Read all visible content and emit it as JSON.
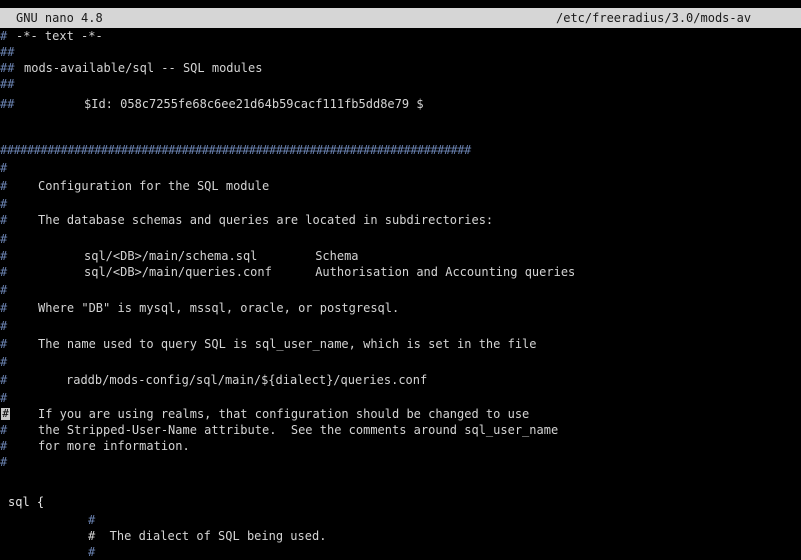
{
  "titlebar": {
    "app_name": "GNU nano 4.8",
    "file_path": "/etc/freeradius/3.0/mods-av"
  },
  "lines": [
    {
      "hash": "#",
      "text": "-*- text -*-"
    },
    {
      "hash": "##",
      "text": ""
    },
    {
      "hash": "##",
      "text": "mods-available/sql -- SQL modules"
    },
    {
      "hash": "##",
      "text": ""
    },
    {
      "hash": "##",
      "text": "$Id: 058c7255fe68c6ee21d64b59cacf111fb5dd8e79 $"
    },
    {
      "hash": "",
      "text": ""
    },
    {
      "hash": "",
      "text": "######################################################################"
    },
    {
      "hash": "#",
      "text": ""
    },
    {
      "hash": "#",
      "text": "Configuration for the SQL module"
    },
    {
      "hash": "#",
      "text": ""
    },
    {
      "hash": "#",
      "text": "The database schemas and queries are located in subdirectories:"
    },
    {
      "hash": "#",
      "text": ""
    },
    {
      "hash": "#",
      "text": "sql/<DB>/main/schema.sql        Schema"
    },
    {
      "hash": "#",
      "text": "sql/<DB>/main/queries.conf      Authorisation and Accounting queries"
    },
    {
      "hash": "#",
      "text": ""
    },
    {
      "hash": "#",
      "text": "Where \"DB\" is mysql, mssql, oracle, or postgresql."
    },
    {
      "hash": "#",
      "text": ""
    },
    {
      "hash": "#",
      "text": "The name used to query SQL is sql_user_name, which is set in the file"
    },
    {
      "hash": "#",
      "text": ""
    },
    {
      "hash": "#",
      "text": "raddb/mods-config/sql/main/${dialect}/queries.conf"
    },
    {
      "hash": "#",
      "text": ""
    },
    {
      "hash": "#",
      "text": "If you are using realms, that configuration should be changed to use"
    },
    {
      "hash": "#",
      "text": "the Stripped-User-Name attribute.  See the comments around sql_user_name"
    },
    {
      "hash": "#",
      "text": "for more information."
    },
    {
      "hash": "#",
      "text": ""
    },
    {
      "hash": "",
      "text": ""
    },
    {
      "hash": "",
      "text": "sql {"
    },
    {
      "hash": "",
      "text": "#"
    },
    {
      "hash": "",
      "text": "#  The dialect of SQL being used."
    },
    {
      "hash": "",
      "text": "#"
    }
  ],
  "colors": {
    "background": "#000000",
    "titlebar": "#d6d6d6",
    "comment_hash": "#6a82b0",
    "text": "#d4d4d4",
    "cursor_block": "#c8c8c8"
  }
}
